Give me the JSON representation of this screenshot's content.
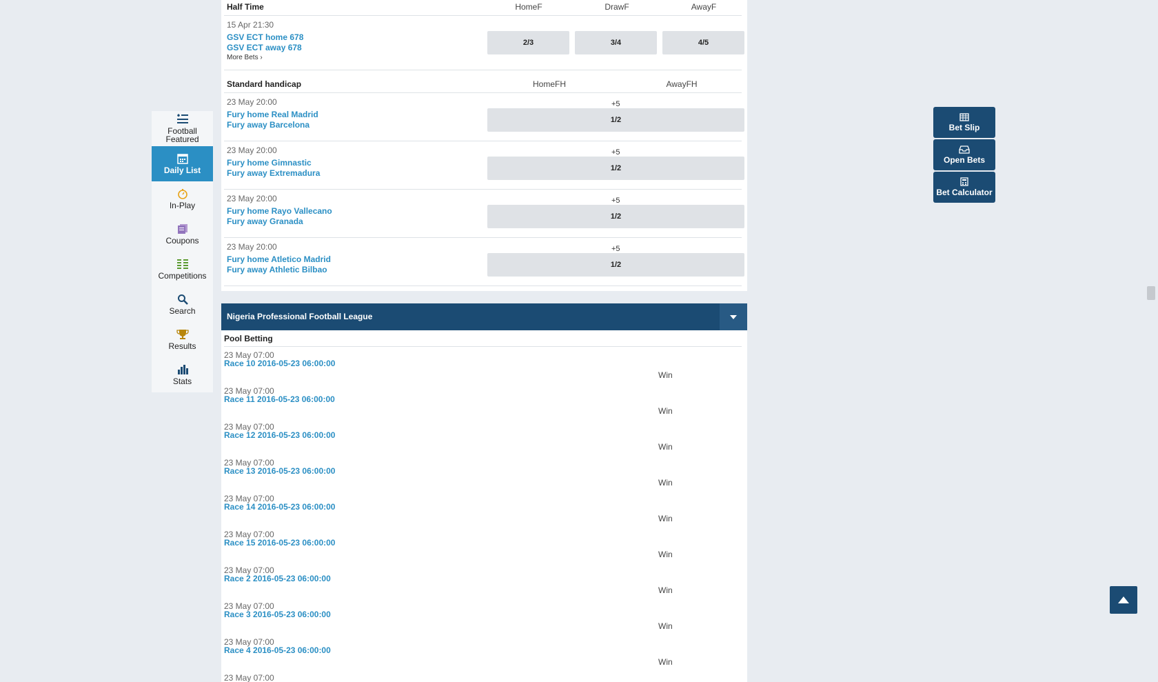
{
  "sidebar": {
    "items": [
      {
        "label": "Football Featured",
        "icon": "football-featured-icon"
      },
      {
        "label": "Daily List",
        "icon": "calendar-icon"
      },
      {
        "label": "In-Play",
        "icon": "stopwatch-icon"
      },
      {
        "label": "Coupons",
        "icon": "coupons-icon"
      },
      {
        "label": "Competitions",
        "icon": "competitions-icon"
      },
      {
        "label": "Search",
        "icon": "search-icon"
      },
      {
        "label": "Results",
        "icon": "trophy-icon"
      },
      {
        "label": "Stats",
        "icon": "bar-chart-icon"
      }
    ],
    "active": "Daily List"
  },
  "half_time": {
    "title": "Half Time",
    "columns": [
      "HomeF",
      "DrawF",
      "AwayF"
    ],
    "event": {
      "date": "15 Apr 21:30",
      "home": "GSV ECT home 678",
      "away": "GSV ECT away 678",
      "more": "More Bets",
      "odds": [
        "2/3",
        "3/4",
        "4/5"
      ]
    }
  },
  "handicap": {
    "title": "Standard handicap",
    "columns": [
      "HomeFH",
      "AwayFH"
    ],
    "events": [
      {
        "date": "23 May 20:00",
        "home": "Fury home Real Madrid",
        "away": "Fury away Barcelona",
        "hcp": "+5",
        "odds": "1/2"
      },
      {
        "date": "23 May 20:00",
        "home": "Fury home Gimnastic",
        "away": "Fury away Extremadura",
        "hcp": "+5",
        "odds": "1/2"
      },
      {
        "date": "23 May 20:00",
        "home": "Fury home Rayo Vallecano",
        "away": "Fury away Granada",
        "hcp": "+5",
        "odds": "1/2"
      },
      {
        "date": "23 May 20:00",
        "home": "Fury home Atletico Madrid",
        "away": "Fury away Athletic Bilbao",
        "hcp": "+5",
        "odds": "1/2"
      }
    ]
  },
  "league": {
    "name": "Nigeria Professional Football League"
  },
  "pool": {
    "title": "Pool Betting",
    "races": [
      {
        "date": "23 May 07:00",
        "name": "Race 10 2016-05-23 06:00:00",
        "market": "Win"
      },
      {
        "date": "23 May 07:00",
        "name": "Race 11 2016-05-23 06:00:00",
        "market": "Win"
      },
      {
        "date": "23 May 07:00",
        "name": "Race 12 2016-05-23 06:00:00",
        "market": "Win"
      },
      {
        "date": "23 May 07:00",
        "name": "Race 13 2016-05-23 06:00:00",
        "market": "Win"
      },
      {
        "date": "23 May 07:00",
        "name": "Race 14 2016-05-23 06:00:00",
        "market": "Win"
      },
      {
        "date": "23 May 07:00",
        "name": "Race 15 2016-05-23 06:00:00",
        "market": "Win"
      },
      {
        "date": "23 May 07:00",
        "name": "Race 2 2016-05-23 06:00:00",
        "market": "Win"
      },
      {
        "date": "23 May 07:00",
        "name": "Race 3 2016-05-23 06:00:00",
        "market": "Win"
      },
      {
        "date": "23 May 07:00",
        "name": "Race 4 2016-05-23 06:00:00",
        "market": "Win"
      },
      {
        "date": "23 May 07:00",
        "name": "",
        "market": ""
      }
    ]
  },
  "right_panel": {
    "bet_slip": "Bet Slip",
    "open_bets": "Open Bets",
    "bet_calculator": "Bet Calculator"
  },
  "colors": {
    "accent": "#2b8fc4",
    "dark": "#1b4b73",
    "odds_bg": "#dfe2e6"
  }
}
